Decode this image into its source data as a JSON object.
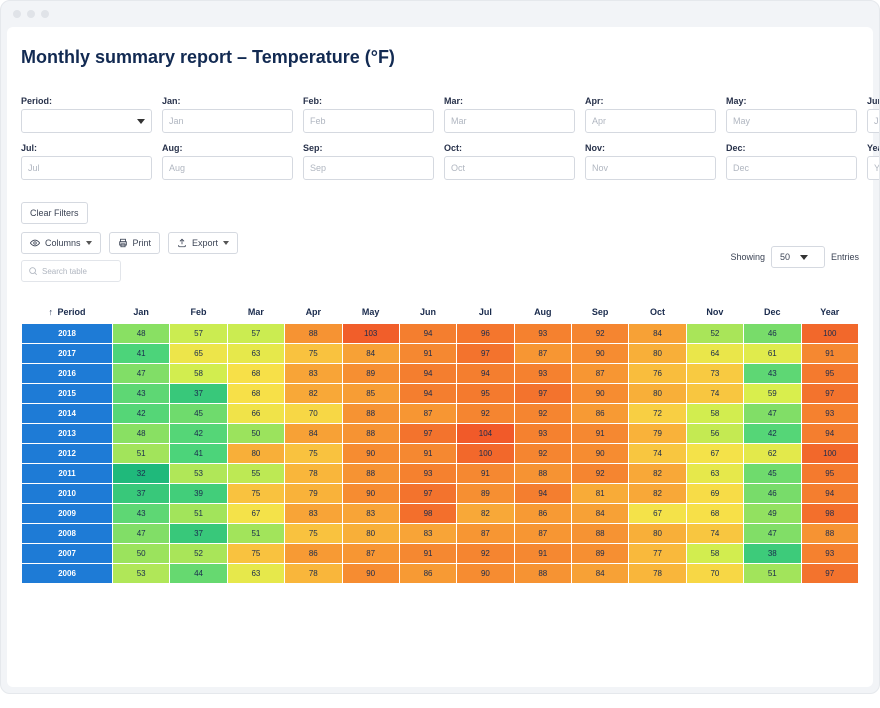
{
  "title": "Monthly summary report – Temperature (°F)",
  "filters": {
    "period_label": "Period:",
    "months": [
      {
        "label": "Jan:",
        "placeholder": "Jan"
      },
      {
        "label": "Feb:",
        "placeholder": "Feb"
      },
      {
        "label": "Mar:",
        "placeholder": "Mar"
      },
      {
        "label": "Apr:",
        "placeholder": "Apr"
      },
      {
        "label": "May:",
        "placeholder": "May"
      },
      {
        "label": "Jun:",
        "placeholder": "Jun"
      },
      {
        "label": "Jul:",
        "placeholder": "Jul"
      },
      {
        "label": "Aug:",
        "placeholder": "Aug"
      },
      {
        "label": "Sep:",
        "placeholder": "Sep"
      },
      {
        "label": "Oct:",
        "placeholder": "Oct"
      },
      {
        "label": "Nov:",
        "placeholder": "Nov"
      },
      {
        "label": "Dec:",
        "placeholder": "Dec"
      },
      {
        "label": "Year:",
        "placeholder": "Year"
      }
    ]
  },
  "toolbar": {
    "clear_filters": "Clear Filters",
    "columns": "Columns",
    "print": "Print",
    "export": "Export",
    "search_placeholder": "Search table",
    "showing": "Showing",
    "page_size": "50",
    "entries": "Entries"
  },
  "table": {
    "headers": [
      "Period",
      "Jan",
      "Feb",
      "Mar",
      "Apr",
      "May",
      "Jun",
      "Jul",
      "Aug",
      "Sep",
      "Oct",
      "Nov",
      "Dec",
      "Year"
    ],
    "sort_indicator": "↑"
  },
  "chart_data": {
    "type": "heatmap",
    "title": "Monthly summary report – Temperature (°F)",
    "row_labels": [
      "2018",
      "2017",
      "2016",
      "2015",
      "2014",
      "2013",
      "2012",
      "2011",
      "2010",
      "2009",
      "2008",
      "2007",
      "2006"
    ],
    "col_labels": [
      "Jan",
      "Feb",
      "Mar",
      "Apr",
      "May",
      "Jun",
      "Jul",
      "Aug",
      "Sep",
      "Oct",
      "Nov",
      "Dec",
      "Year"
    ],
    "values": [
      [
        48,
        57,
        57,
        88,
        103,
        94,
        96,
        93,
        92,
        84,
        52,
        46,
        100
      ],
      [
        41,
        65,
        63,
        75,
        84,
        91,
        97,
        87,
        90,
        80,
        64,
        61,
        91
      ],
      [
        47,
        58,
        68,
        83,
        89,
        94,
        94,
        93,
        87,
        76,
        73,
        43,
        95
      ],
      [
        43,
        37,
        68,
        82,
        85,
        94,
        95,
        97,
        90,
        80,
        74,
        59,
        97
      ],
      [
        42,
        45,
        66,
        70,
        88,
        87,
        92,
        92,
        86,
        72,
        58,
        47,
        93
      ],
      [
        48,
        42,
        50,
        84,
        88,
        97,
        104,
        93,
        91,
        79,
        56,
        42,
        94
      ],
      [
        51,
        41,
        80,
        75,
        90,
        91,
        100,
        92,
        90,
        74,
        67,
        62,
        100
      ],
      [
        32,
        53,
        55,
        78,
        88,
        93,
        91,
        88,
        92,
        82,
        63,
        45,
        95
      ],
      [
        37,
        39,
        75,
        79,
        90,
        97,
        89,
        94,
        81,
        82,
        69,
        46,
        94
      ],
      [
        43,
        51,
        67,
        83,
        83,
        98,
        82,
        86,
        84,
        67,
        68,
        49,
        98
      ],
      [
        47,
        37,
        51,
        75,
        80,
        83,
        87,
        87,
        88,
        80,
        74,
        47,
        88
      ],
      [
        50,
        52,
        75,
        86,
        87,
        91,
        92,
        91,
        89,
        77,
        58,
        38,
        93
      ],
      [
        53,
        44,
        63,
        78,
        90,
        86,
        90,
        88,
        84,
        78,
        70,
        51,
        97
      ]
    ],
    "color_ramp_hex": [
      "#1fb97b",
      "#4cd47a",
      "#9be35d",
      "#d9ee4d",
      "#f7e048",
      "#f9b93c",
      "#f79a34",
      "#f47a2e",
      "#f15a29"
    ],
    "value_range": [
      32,
      104
    ]
  }
}
